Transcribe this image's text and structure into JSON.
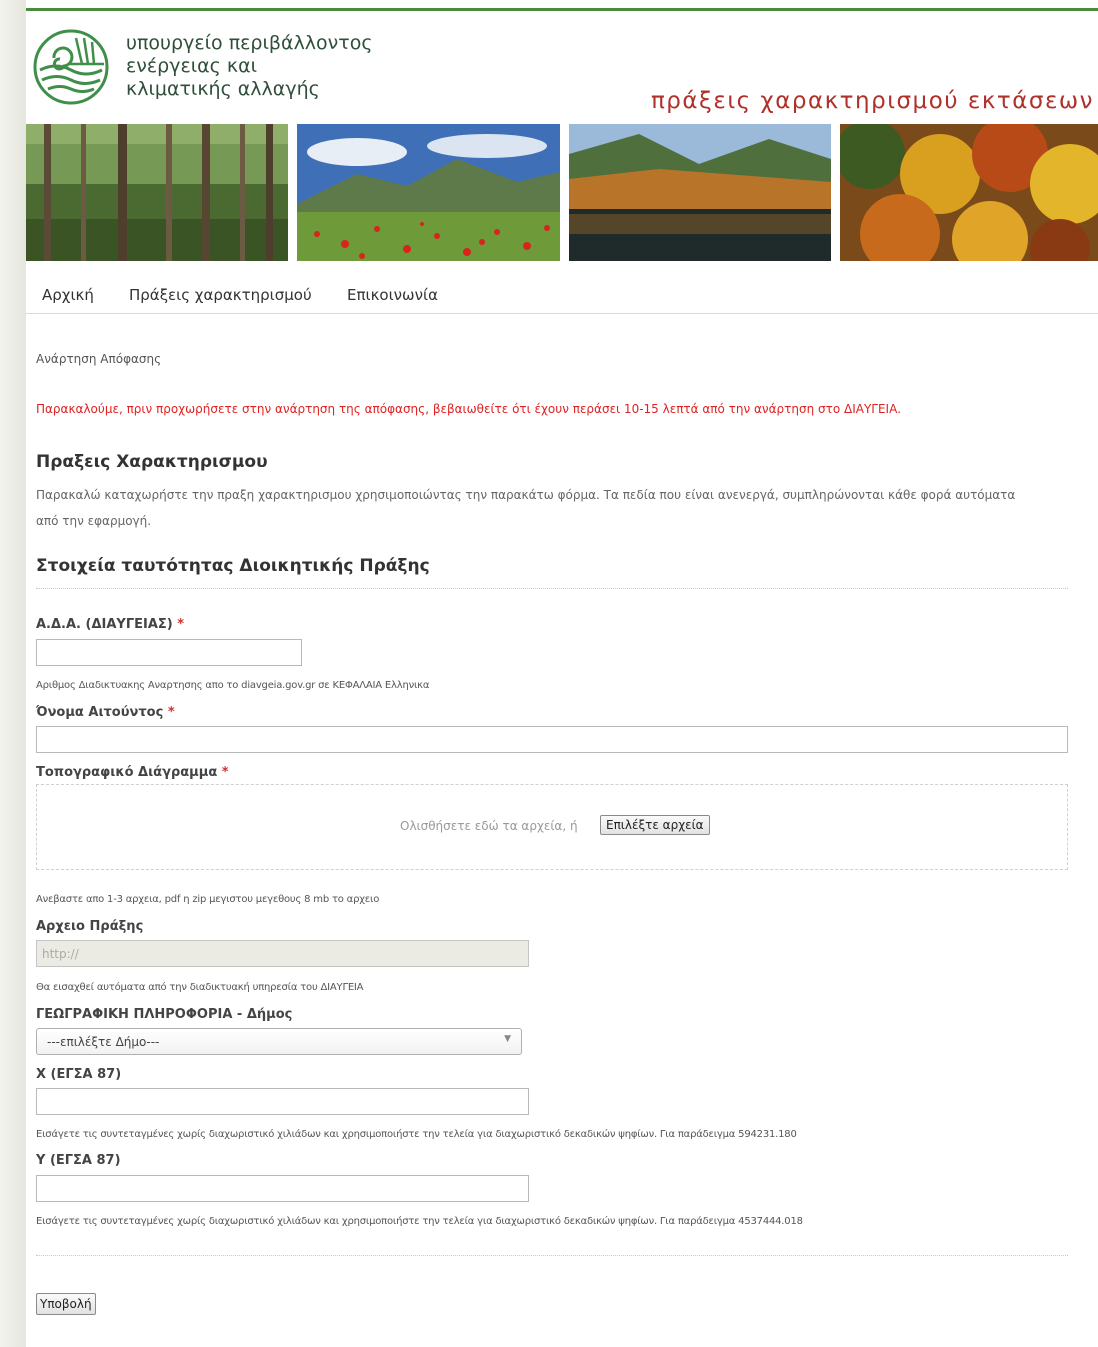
{
  "header": {
    "ministry_lines": [
      "υπουργείο περιβάλλοντος",
      "ενέργειας και",
      "κλιματικής αλλαγής"
    ],
    "site_title": "πράξεις χαρακτηρισμού εκτάσεων"
  },
  "nav": {
    "items": [
      "Αρχική",
      "Πράξεις χαρακτηρισμού",
      "Επικοινωνία"
    ]
  },
  "page": {
    "breadcrumb": "Ανάρτηση Απόφασης",
    "alert": "Παρακαλούμε, πριν προχωρήσετε στην ανάρτηση της απόφασης, βεβαιωθείτε ότι έχουν περάσει 10-15 λεπτά από την ανάρτηση στο ΔΙΑΥΓΕΙΑ.",
    "section_title": "Πραξεις Χαρακτηρισμου",
    "intro": "Παρακαλώ καταχωρήστε την πραξη χαρακτηρισμου χρησιμοποιώντας την παρακάτω φόρμα. Τα πεδία που είναι ανενεργά, συμπληρώνονται κάθε φορά αυτόματα από την εφαρμογή.",
    "identity_title": "Στοιχεία ταυτότητας Διοικητικής Πράξης"
  },
  "form": {
    "required_mark": "*",
    "ada": {
      "label": "Α.Δ.Α. (ΔΙΑΥΓΕΙΑΣ)",
      "value": "",
      "help": "Αριθμος Διαδικτυακης Αναρτησης απο το diavgeia.gov.gr σε ΚΕΦΑΛΑΙΑ Ελληνικα"
    },
    "applicant": {
      "label": "Όνομα Αιτούντος",
      "value": ""
    },
    "topo": {
      "label": "Τοπογραφικό Διάγραμμα",
      "drop_text": "Ολισθήσετε εδώ τα αρχεία, ή",
      "choose_button": "Επιλέξτε αρχεία",
      "help": "Ανεβαστε απο 1-3 αρχεια, pdf η zip μεγιστου μεγεθους 8 mb το αρχειο"
    },
    "act_file": {
      "label": "Αρχειο Πράξης",
      "value": "http://",
      "help": "Θα εισαχθεί αυτόματα από την διαδικτυακή υπηρεσία του ΔΙΑΥΓΕΙΑ"
    },
    "municipality": {
      "label": "ΓΕΩΓΡΑΦΙΚΗ ΠΛΗΡΟΦΟΡΙΑ - Δήμος",
      "selected": "---επιλέξτε Δήμο---"
    },
    "x_coord": {
      "label": "X (ΕΓΣΑ 87)",
      "value": "",
      "help": "Εισάγετε τις συντεταγμένες χωρίς διαχωριστικό χιλιάδων και χρησιμοποιήστε την τελεία για διαχωριστικό δεκαδικών ψηφίων. Για παράδειγμα 594231.180"
    },
    "y_coord": {
      "label": "Y (ΕΓΣΑ 87)",
      "value": "",
      "help": "Εισάγετε τις συντεταγμένες χωρίς διαχωριστικό χιλιάδων και χρησιμοποιήστε την τελεία για διαχωριστικό δεκαδικών ψηφίων. Για παράδειγμα 4537444.018"
    },
    "submit_label": "Υποβολή"
  },
  "colors": {
    "brand_green": "#4a8a3c",
    "title_red": "#b0302a",
    "alert_red": "#e02222"
  }
}
